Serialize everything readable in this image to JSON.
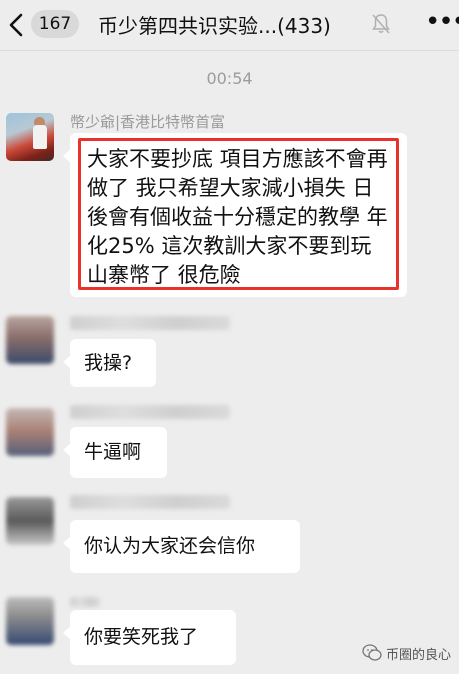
{
  "header": {
    "unread_count": "167",
    "title": "币少第四共识实验...(433)"
  },
  "timestamp": "00:54",
  "messages": [
    {
      "sender": "幣少爺|香港比特幣首富",
      "text": "大家不要抄底 項目方應該不會再做了 我只希望大家減小損失 日後會有個收益十分穩定的教學 年化25% 這次教訓大家不要到玩山寨幣了 很危險"
    },
    {
      "text": "我操?"
    },
    {
      "text": "牛逼啊"
    },
    {
      "text": "你认为大家还会信你"
    },
    {
      "text": "你要笑死我了"
    }
  ],
  "watermark": {
    "text": "币圈的良心"
  },
  "colors": {
    "background": "#ededed",
    "bubble": "#ffffff",
    "highlight_border": "#e8322c",
    "meta_text": "#9c9c9c"
  }
}
